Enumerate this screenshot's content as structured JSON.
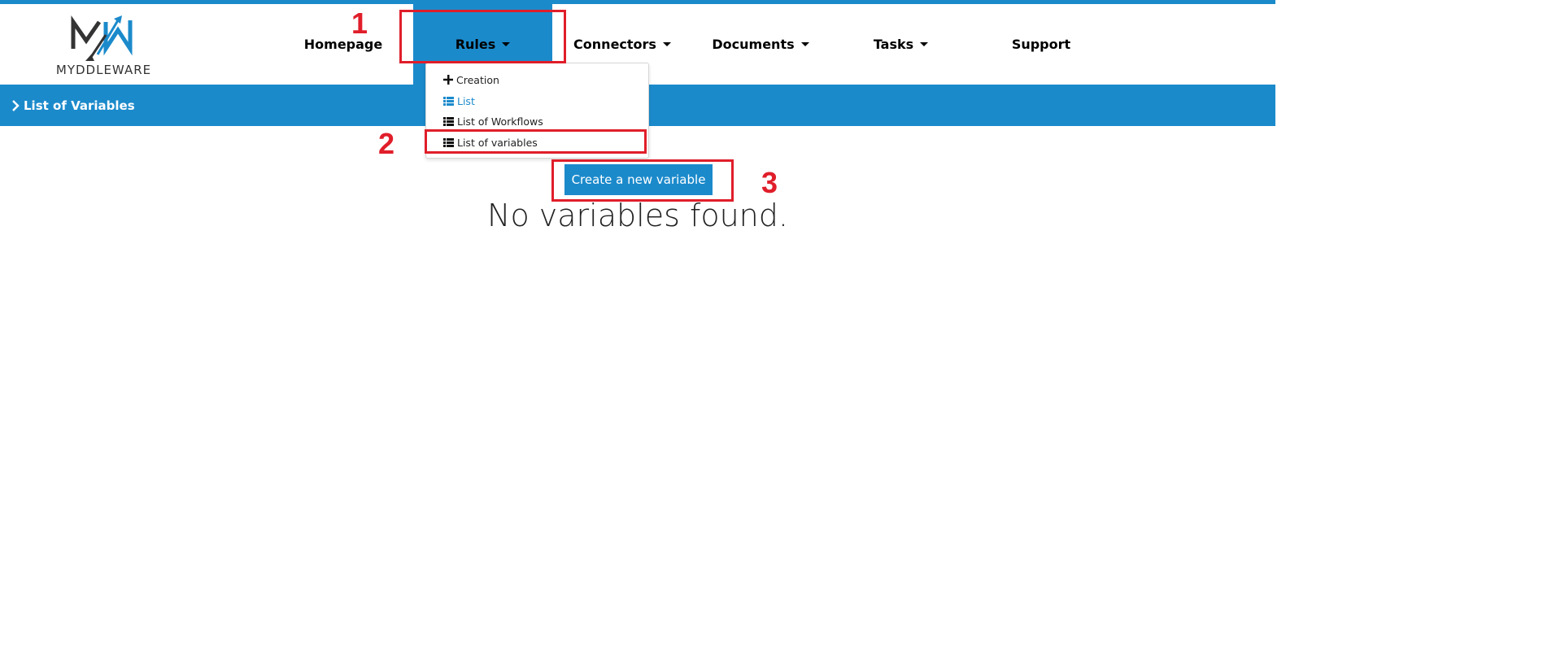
{
  "brand": {
    "logo_text": "MYDDLEWARE"
  },
  "nav": {
    "items": [
      {
        "label": "Homepage"
      },
      {
        "label": "Rules"
      },
      {
        "label": "Connectors"
      },
      {
        "label": "Documents"
      },
      {
        "label": "Tasks"
      },
      {
        "label": "Support"
      }
    ]
  },
  "rules_menu": {
    "items": [
      {
        "label": "Creation",
        "icon": "plus-icon"
      },
      {
        "label": "List",
        "icon": "list-icon"
      },
      {
        "label": "List of Workflows",
        "icon": "list-icon"
      },
      {
        "label": "List of variables",
        "icon": "list-icon"
      }
    ]
  },
  "breadcrumb": {
    "label": "List of Variables"
  },
  "main": {
    "create_button_label": "Create a new variable",
    "empty_message": "No variables found."
  },
  "annotations": {
    "step1": "1",
    "step2": "2",
    "step3": "3"
  },
  "colors": {
    "accent": "#1b8acb",
    "annotation": "#e01e2a"
  }
}
